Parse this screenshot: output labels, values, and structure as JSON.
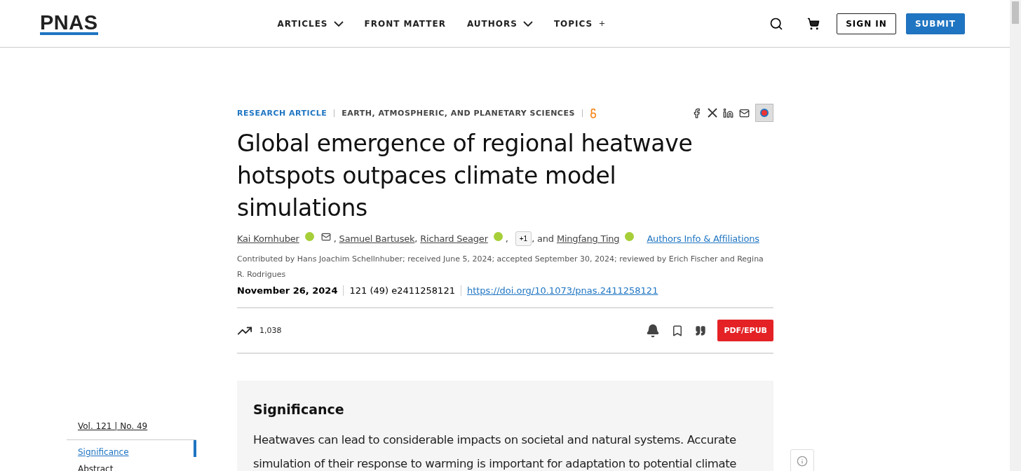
{
  "header": {
    "logo": "PNAS",
    "nav": [
      {
        "label": "ARTICLES",
        "kind": "dropdown"
      },
      {
        "label": "FRONT MATTER",
        "kind": "link"
      },
      {
        "label": "AUTHORS",
        "kind": "dropdown"
      },
      {
        "label": "TOPICS",
        "kind": "plus"
      }
    ],
    "sign_in": "SIGN IN",
    "submit": "SUBMIT"
  },
  "article": {
    "type": "RESEARCH ARTICLE",
    "section": "EARTH, ATMOSPHERIC, AND PLANETARY SCIENCES",
    "open_access": true,
    "title": "Global emergence of regional heatwave hotspots outpaces climate model simulations",
    "authors": [
      {
        "name": "Kai Kornhuber",
        "orcid": true,
        "email": true,
        "sep": ","
      },
      {
        "name": "Samuel Bartusek",
        "orcid": false,
        "email": false,
        "sep": ","
      },
      {
        "name": "Richard Seager",
        "orcid": true,
        "email": false,
        "sep": ","
      }
    ],
    "more_authors": "+1",
    "and": ", and",
    "last_author": {
      "name": "Mingfang Ting",
      "orcid": true,
      "email": false
    },
    "affiliations_link": "Authors Info & Affiliations",
    "contributed": "Contributed by Hans Joachim Schellnhuber; received June 5, 2024; accepted September 30, 2024; reviewed by Erich Fischer and Regina R. Rodrigues",
    "date": "November 26, 2024",
    "citation": "121 (49) e2411258121",
    "doi": "https://doi.org/10.1073/pnas.2411258121",
    "metric": "1,038",
    "pdf": "PDF/EPUB"
  },
  "sidebar": {
    "volume": "Vol. 121 | No. 49",
    "items": [
      {
        "label": "Significance",
        "selected": true
      },
      {
        "label": "Abstract",
        "selected": false
      }
    ]
  },
  "significance": {
    "heading": "Significance",
    "text": "Heatwaves can lead to considerable impacts on societal and natural systems. Accurate simulation of their response to warming is important for adaptation to potential climate"
  }
}
